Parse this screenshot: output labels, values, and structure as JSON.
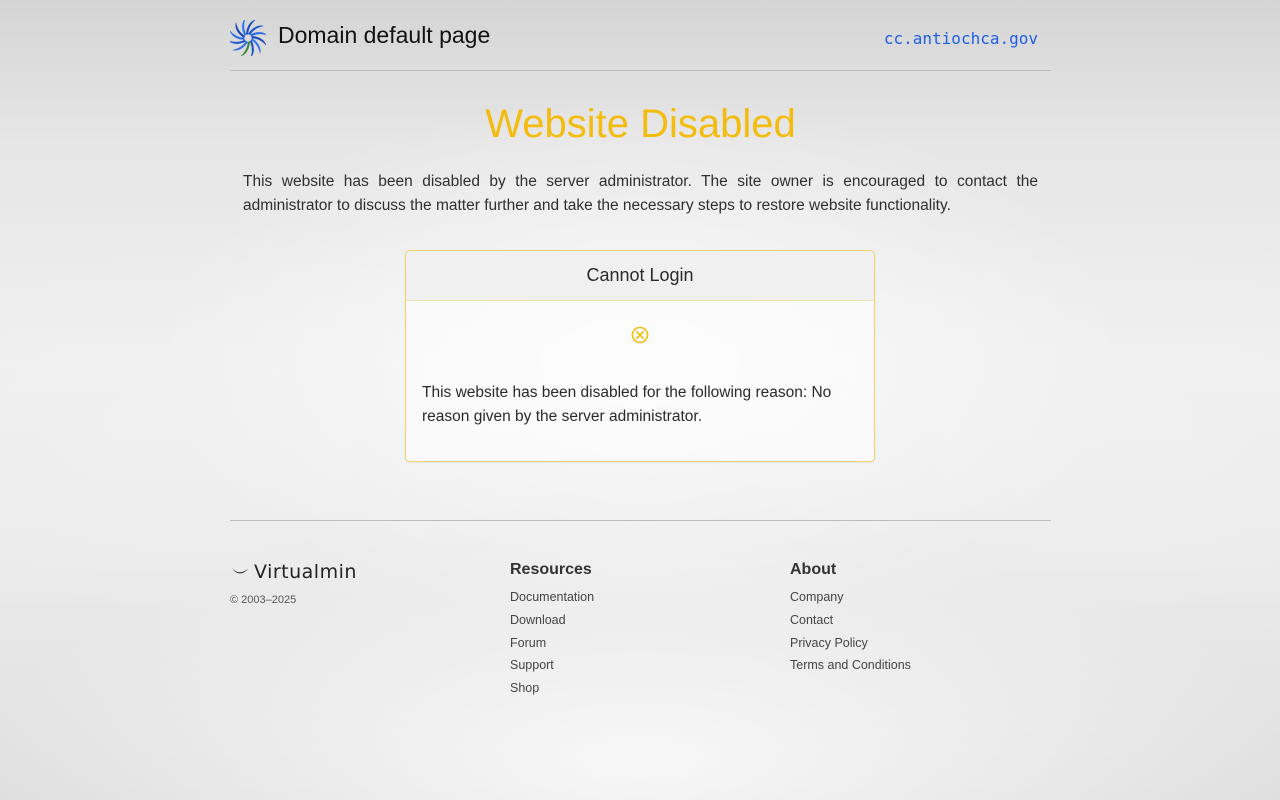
{
  "header": {
    "title": "Domain default page",
    "domain": "cc.antiochca.gov",
    "logo_icon": "virtualmin-swirl-icon"
  },
  "main": {
    "heading": "Website Disabled",
    "intro": "This website has been disabled by the server administrator. The site owner is encouraged to contact the administrator to discuss the matter further and take the necessary steps to restore website functionality.",
    "heading_color": "#f4bc0e"
  },
  "card": {
    "title": "Cannot Login",
    "icon": "error-circle-x-icon",
    "message": "This website has been disabled for the following reason: No reason given by the server administrator."
  },
  "footer": {
    "brand": "Virtualmin",
    "copyright": "© 2003–2025",
    "resources": {
      "title": "Resources",
      "links": [
        "Documentation",
        "Download",
        "Forum",
        "Support",
        "Shop"
      ]
    },
    "about": {
      "title": "About",
      "links": [
        "Company",
        "Contact",
        "Privacy Policy",
        "Terms and Conditions"
      ]
    }
  }
}
